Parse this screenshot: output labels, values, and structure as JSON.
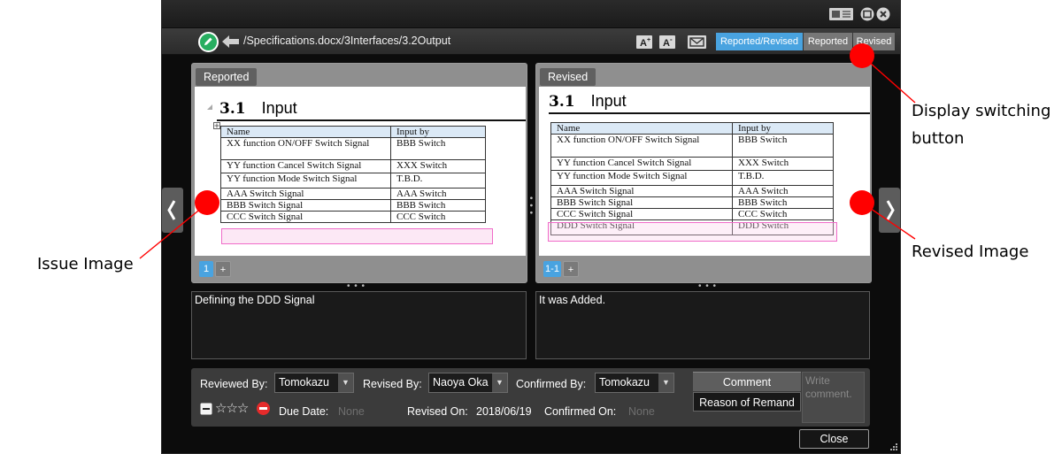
{
  "toolbar": {
    "path": "/Specifications.docx/3Interfaces/3.2Output",
    "view_modes": [
      "Reported/Revised",
      "Reported",
      "Revised"
    ]
  },
  "reported": {
    "label": "Reported",
    "heading_num": "3.1",
    "heading_text": "Input",
    "table_header": [
      "Name",
      "Input by"
    ],
    "rows": [
      [
        "XX function ON/OFF Switch Signal",
        "BBB Switch"
      ],
      [
        "YY function Cancel Switch Signal",
        "XXX Switch"
      ],
      [
        "YY function Mode Switch Signal",
        "T.B.D."
      ],
      [
        "AAA Switch Signal",
        "AAA Switch"
      ],
      [
        "BBB Switch Signal",
        "BBB Switch"
      ],
      [
        "CCC Switch Signal",
        "CCC Switch"
      ]
    ],
    "page": "1",
    "add": "+",
    "comment": "Defining the DDD Signal"
  },
  "revised": {
    "label": "Revised",
    "heading_num": "3.1",
    "heading_text": "Input",
    "table_header": [
      "Name",
      "Input by"
    ],
    "rows": [
      [
        "XX function ON/OFF Switch Signal",
        "BBB Switch"
      ],
      [
        "YY function Cancel Switch Signal",
        "XXX Switch"
      ],
      [
        "YY function Mode Switch Signal",
        "T.B.D."
      ],
      [
        "AAA Switch Signal",
        "AAA Switch"
      ],
      [
        "BBB Switch Signal",
        "BBB Switch"
      ],
      [
        "CCC Switch Signal",
        "CCC Switch"
      ],
      [
        "DDD Switch Signal",
        "DDD Switch"
      ]
    ],
    "page": "1-1",
    "add": "+",
    "comment": "It was Added."
  },
  "form": {
    "reviewed_by_label": "Reviewed By:",
    "reviewed_by": "Tomokazu",
    "revised_by_label": "Revised By:",
    "revised_by": "Naoya Oka",
    "confirmed_by_label": "Confirmed By:",
    "confirmed_by": "Tomokazu",
    "due_date_label": "Due Date:",
    "due_date": "None",
    "revised_on_label": "Revised On:",
    "revised_on": "2018/06/19",
    "confirmed_on_label": "Confirmed On:",
    "confirmed_on": "None",
    "stars": "☆☆☆",
    "comment_tab": "Comment",
    "remand_tab": "Reason of Remand",
    "write_placeholder": "Write comment."
  },
  "close_label": "Close",
  "annotations": {
    "display_switching_1": "Display switching",
    "display_switching_2": "button",
    "issue_image": "Issue Image",
    "revised_image": "Revised Image"
  },
  "colors": {
    "accent_blue": "#49a3e0",
    "annotation_red": "#ff0000",
    "highlight_pink": "#f06cc9",
    "edit_green": "#27ae60"
  }
}
